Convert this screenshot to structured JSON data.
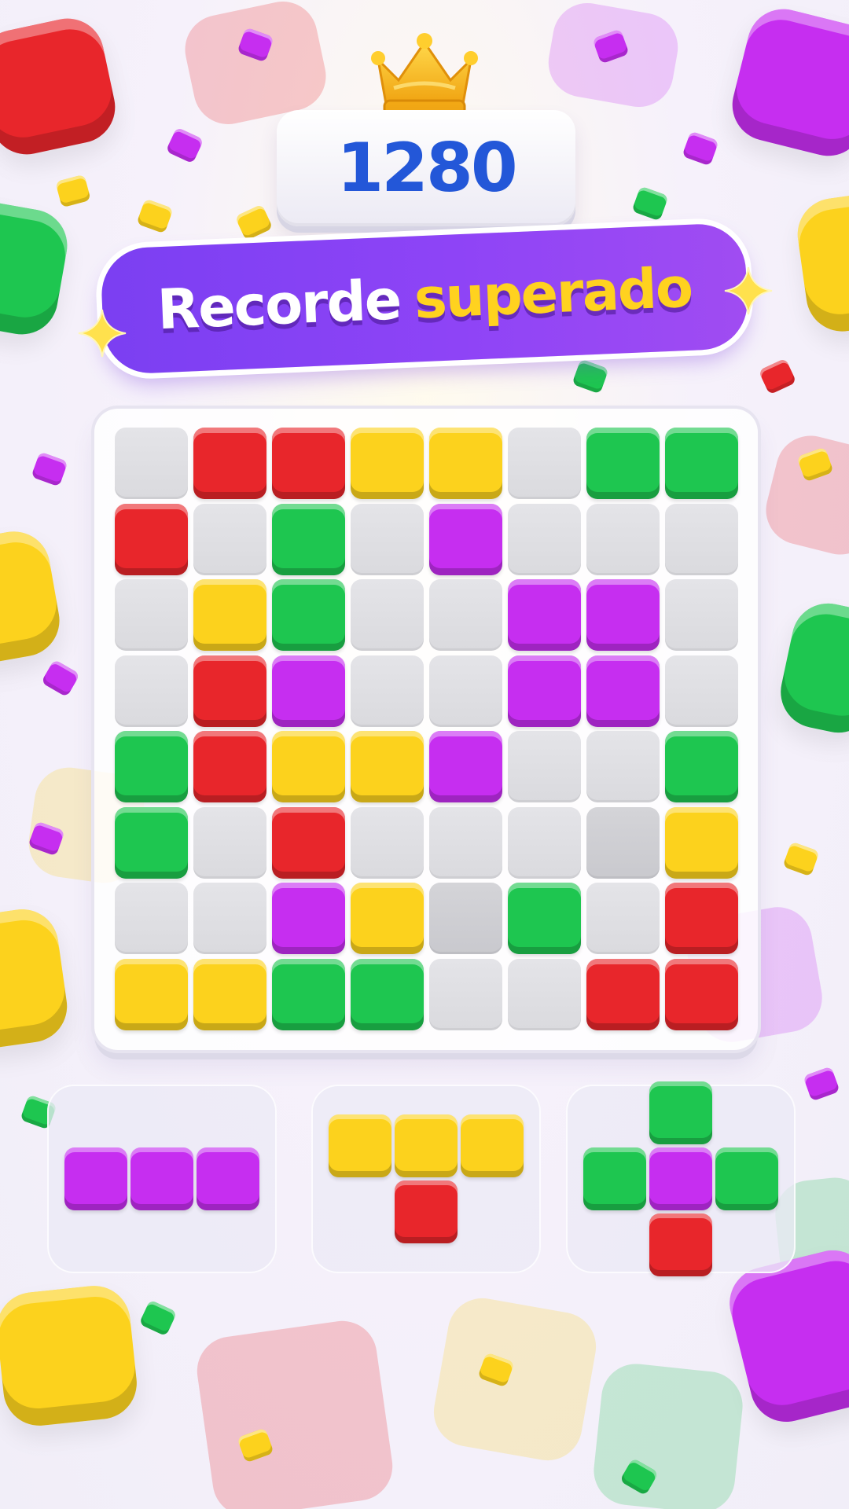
{
  "score": "1280",
  "banner": {
    "word1": "Recorde",
    "word2": "superado"
  },
  "colors": {
    "red": "#e8262b",
    "yellow": "#fcd21d",
    "green": "#1ec650",
    "purple": "#c62ef0",
    "empty": "#dcdce0",
    "score_text": "#2357d8",
    "banner": "#8a45f4"
  },
  "board": {
    "rows": 8,
    "cols": 8,
    "cells": [
      [
        "empty",
        "red",
        "red",
        "yellow",
        "yellow",
        "empty",
        "green",
        "green"
      ],
      [
        "red",
        "empty",
        "green",
        "empty",
        "purple",
        "empty",
        "empty",
        "empty"
      ],
      [
        "empty",
        "yellow",
        "green",
        "empty",
        "empty",
        "purple",
        "purple",
        "empty"
      ],
      [
        "empty",
        "red",
        "purple",
        "empty",
        "empty",
        "purple",
        "purple",
        "empty"
      ],
      [
        "green",
        "red",
        "yellow",
        "yellow",
        "purple",
        "empty",
        "empty",
        "green"
      ],
      [
        "green",
        "empty",
        "red",
        "empty",
        "empty",
        "empty",
        "dim",
        "yellow"
      ],
      [
        "empty",
        "empty",
        "purple",
        "yellow",
        "dim",
        "green",
        "empty",
        "red"
      ],
      [
        "yellow",
        "yellow",
        "green",
        "green",
        "empty",
        "empty",
        "red",
        "red"
      ]
    ]
  },
  "pieces": [
    {
      "name": "purple-line-piece",
      "shape": [
        [
          0,
          0,
          "purple"
        ],
        [
          0,
          1,
          "purple"
        ],
        [
          0,
          2,
          "purple"
        ]
      ]
    },
    {
      "name": "t-piece",
      "shape": [
        [
          0,
          0,
          "yellow"
        ],
        [
          0,
          1,
          "yellow"
        ],
        [
          0,
          2,
          "yellow"
        ],
        [
          1,
          1,
          "red"
        ]
      ]
    },
    {
      "name": "plus-piece",
      "shape": [
        [
          0,
          1,
          "green"
        ],
        [
          1,
          0,
          "green"
        ],
        [
          1,
          1,
          "purple"
        ],
        [
          1,
          2,
          "green"
        ],
        [
          2,
          1,
          "red"
        ]
      ]
    }
  ],
  "icons": {
    "crown": "crown-icon",
    "sparkle": "sparkle-icon"
  }
}
